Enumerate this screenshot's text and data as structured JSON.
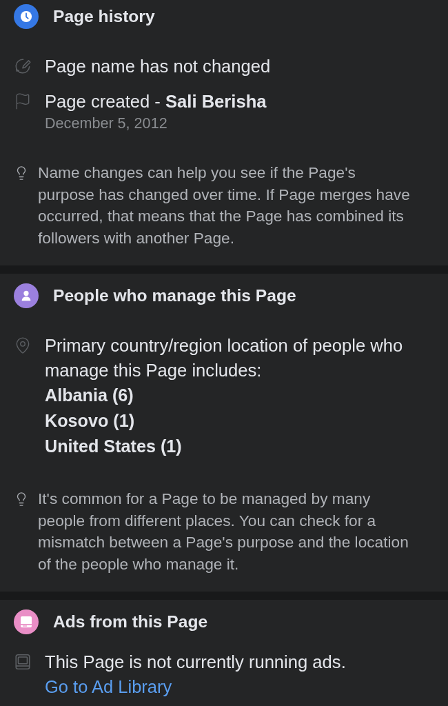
{
  "sections": [
    {
      "kind": "history",
      "color": "#3578e5",
      "title": "Page history",
      "items": [
        {
          "kind": "name",
          "text": "Page name has not changed"
        },
        {
          "kind": "created",
          "text": "Page created - **Sali Berisha**",
          "date": "December 5, 2012"
        }
      ],
      "tip": "Name changes can help you see if the Page's purpose has changed over time. If Page merges have occurred, that means that the Page has combined its followers with another Page."
    },
    {
      "kind": "managers",
      "color": "#9b80de",
      "title": "People who manage this Page",
      "items": [
        {
          "kind": "location",
          "text": "Primary country/region location of people who manage this Page includes:",
          "countries": [
            "Albania (6)",
            "Kosovo (1)",
            "United States (1)"
          ]
        }
      ],
      "tip": "It's common for a Page to be managed by many people from different places. You can check for a mismatch between a Page's purpose and the location of the people who manage it."
    },
    {
      "kind": "ads",
      "color": "#e98ec6",
      "title": "Ads from this Page",
      "items": [
        {
          "kind": "ads",
          "text": "This Page is not currently running ads.",
          "link": "Go to Ad Library"
        }
      ]
    }
  ]
}
